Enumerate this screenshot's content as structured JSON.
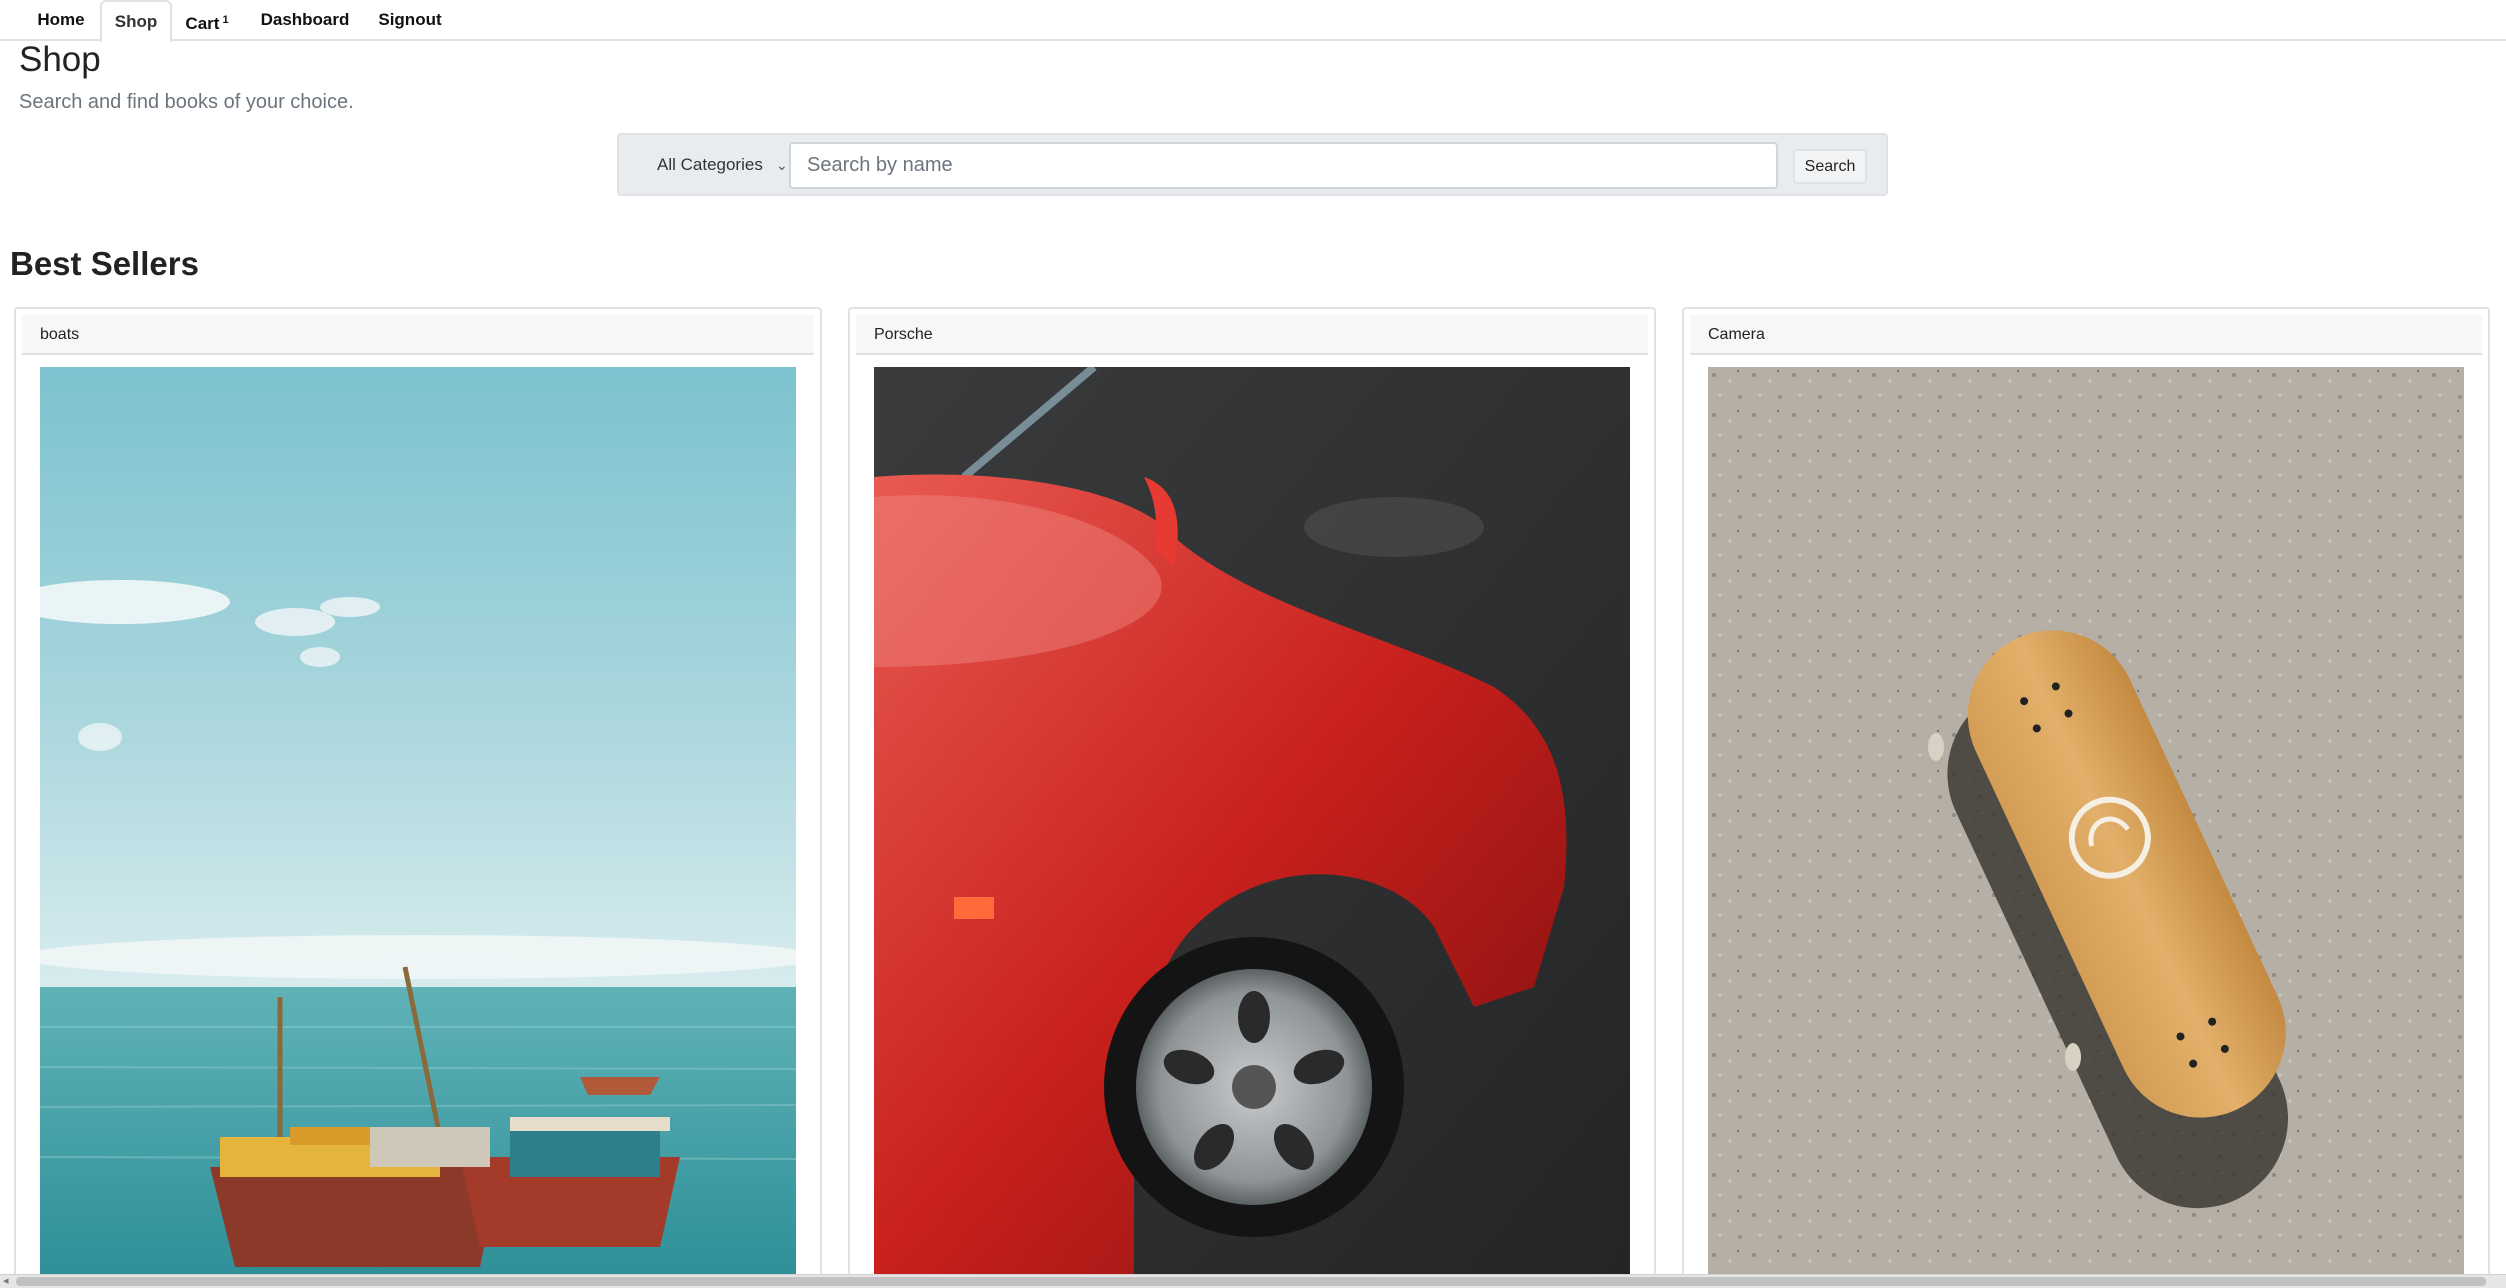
{
  "nav": {
    "items": [
      {
        "label": "Home"
      },
      {
        "label": "Shop"
      },
      {
        "label": "Cart"
      },
      {
        "label": "Dashboard"
      },
      {
        "label": "Signout"
      }
    ],
    "cart_count": "1",
    "active": "Shop"
  },
  "header": {
    "title": "Shop",
    "description": "Search and find books of your choice."
  },
  "search": {
    "category_selected": "All Categories",
    "placeholder": "Search by name",
    "button_label": "Search"
  },
  "best_sellers": {
    "title": "Best Sellers",
    "products": [
      {
        "name": "boats",
        "image": "boats-photo"
      },
      {
        "name": "Porsche",
        "image": "red-car-photo"
      },
      {
        "name": "Camera",
        "image": "skateboard-photo"
      }
    ]
  },
  "colors": {
    "border": "#dee2e6",
    "muted_text": "#6c757d",
    "search_bg": "#e9ecef"
  }
}
